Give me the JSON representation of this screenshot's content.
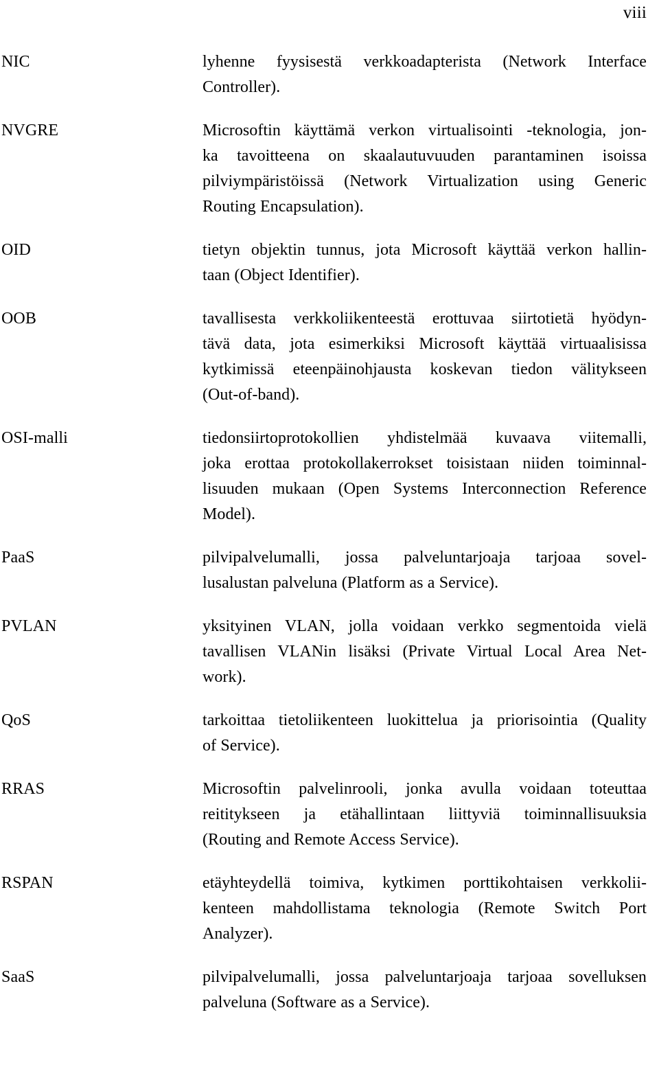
{
  "document": {
    "page_number": "viii",
    "type": "glossary-of-abbreviations",
    "language": "fi"
  },
  "entries": [
    {
      "term": "NIC",
      "definition": "lyhenne fyysisestä verkkoadapterista (Network Interface Controller).",
      "lines": [
        "lyhenne fyysisestä verkkoadapterista (Network Interface",
        "Controller)."
      ]
    },
    {
      "term": "NVGRE",
      "definition": "Microsoftin käyttämä verkon virtualisointi -teknologia, jonka tavoitteena on skaalautuvuuden parantaminen isoissa pilviympäristöissä (Network Virtualization using Generic Routing Encapsulation).",
      "lines": [
        "Microsoftin käyttämä verkon virtualisointi -teknologia, jon-",
        "ka tavoitteena on skaalautuvuuden parantaminen isoissa",
        "pilviympäristöissä (Network Virtualization using Generic",
        "Routing Encapsulation)."
      ]
    },
    {
      "term": "OID",
      "definition": "tietyn objektin tunnus, jota Microsoft käyttää verkon hallintaan (Object Identifier).",
      "lines": [
        "tietyn objektin tunnus, jota Microsoft käyttää verkon hallin-",
        "taan (Object Identifier)."
      ]
    },
    {
      "term": "OOB",
      "definition": "tavallisesta verkkoliikenteestä erottuvaa siirtotietä hyödyntävä data, jota esimerkiksi Microsoft käyttää virtuaalisissa kytkimissä eteenpäinohjausta koskevan tiedon välitykseen (Out-of-band).",
      "lines": [
        "tavallisesta verkkoliikenteestä erottuvaa siirtotietä hyödyn-",
        "tävä data, jota esimerkiksi Microsoft käyttää virtuaalisissa",
        "kytkimissä eteenpäinohjausta koskevan tiedon välitykseen",
        "(Out-of-band)."
      ]
    },
    {
      "term": "OSI-malli",
      "definition": "tiedonsiirtoprotokollien yhdistelmää kuvaava viitemalli, joka erottaa protokollakerrokset toisistaan niiden toiminnallisuuden mukaan (Open Systems Interconnection Reference Model).",
      "lines": [
        "tiedonsiirtoprotokollien yhdistelmää kuvaava viitemalli,",
        "joka erottaa protokollakerrokset toisistaan niiden toiminnal-",
        "lisuuden mukaan (Open Systems Interconnection Reference",
        "Model)."
      ]
    },
    {
      "term": "PaaS",
      "definition": "pilvipalvelumalli, jossa palveluntarjoaja tarjoaa sovellusalustan palveluna (Platform as a Service).",
      "lines": [
        "pilvipalvelumalli, jossa palveluntarjoaja tarjoaa sovel-",
        "lusalustan palveluna (Platform as a Service)."
      ]
    },
    {
      "term": "PVLAN",
      "definition": "yksityinen VLAN, jolla voidaan verkko segmentoida vielä tavallisen VLANin lisäksi (Private Virtual Local Area Network).",
      "lines": [
        "yksityinen VLAN, jolla voidaan verkko segmentoida vielä",
        "tavallisen VLANin lisäksi (Private Virtual Local Area Net-",
        "work)."
      ]
    },
    {
      "term": "QoS",
      "definition": "tarkoittaa tietoliikenteen luokittelua ja priorisointia (Quality of Service).",
      "lines": [
        "tarkoittaa tietoliikenteen luokittelua ja priorisointia (Quality",
        "of Service)."
      ]
    },
    {
      "term": "RRAS",
      "definition": "Microsoftin palvelinrooli, jonka avulla voidaan toteuttaa reititykseen ja etähallintaan liittyviä toiminnallisuuksia (Routing and Remote Access Service).",
      "lines": [
        "Microsoftin palvelinrooli, jonka avulla voidaan toteuttaa",
        "reititykseen ja etähallintaan liittyviä toiminnallisuuksia",
        "(Routing and Remote Access Service)."
      ]
    },
    {
      "term": "RSPAN",
      "definition": "etäyhteydellä toimiva, kytkimen porttikohtaisen verkkoliikenteen mahdollistama teknologia (Remote Switch Port Analyzer).",
      "lines": [
        "etäyhteydellä toimiva, kytkimen porttikohtaisen verkkolii-",
        "kenteen mahdollistama teknologia (Remote Switch Port",
        "Analyzer)."
      ]
    },
    {
      "term": "SaaS",
      "definition": "pilvipalvelumalli, jossa palveluntarjoaja tarjoaa sovelluksen palveluna (Software as a Service).",
      "lines": [
        "pilvipalvelumalli, jossa palveluntarjoaja tarjoaa sovelluksen",
        "palveluna (Software as a Service)."
      ]
    }
  ]
}
